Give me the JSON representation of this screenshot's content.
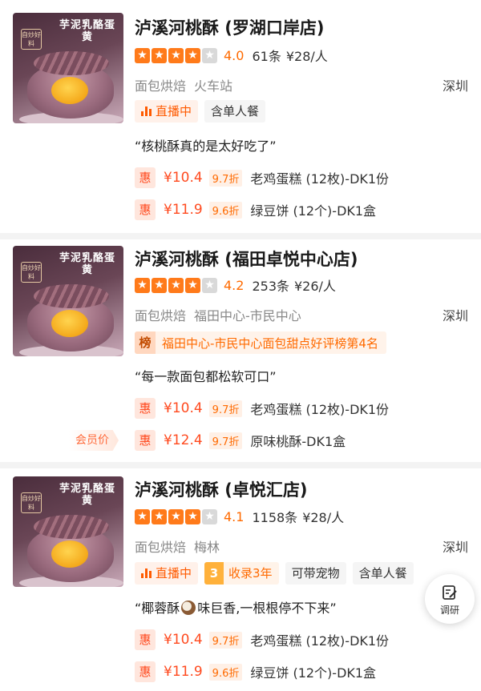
{
  "listings": [
    {
      "image_banner": "芋泥乳酪蛋黄",
      "image_badge": "自炒好料",
      "title": "泸溪河桃酥 (罗湖口岸店)",
      "stars_filled": 4,
      "score": "4.0",
      "reviews": "61条",
      "price": "¥28/人",
      "category": "面包烘焙",
      "area": "火车站",
      "city": "深圳",
      "tags": [
        "直播中",
        "含单人餐"
      ],
      "quote": "“核桃酥真的是太好吃了”",
      "deals": [
        {
          "badge": "惠",
          "price": "¥10.4",
          "discount": "9.7折",
          "name": "老鸡蛋糕 (12枚)-DK1份"
        },
        {
          "badge": "惠",
          "price": "¥11.9",
          "discount": "9.6折",
          "name": "绿豆饼 (12个)-DK1盒"
        }
      ]
    },
    {
      "image_banner": "芋泥乳酪蛋黄",
      "image_badge": "自炒好料",
      "title": "泸溪河桃酥 (福田卓悦中心店)",
      "stars_filled": 4,
      "score": "4.2",
      "reviews": "253条",
      "price": "¥26/人",
      "category": "面包烘焙",
      "area": "福田中心-市民中心",
      "city": "深圳",
      "rank_badge": "榜",
      "rank_text": "福田中心-市民中心面包甜点好评榜第4名",
      "quote": "“每一款面包都松软可口”",
      "member_label": "会员价",
      "deals": [
        {
          "badge": "惠",
          "price": "¥10.4",
          "discount": "9.7折",
          "name": "老鸡蛋糕 (12枚)-DK1份"
        },
        {
          "badge": "惠",
          "price": "¥12.4",
          "discount": "9.7折",
          "name": "原味桃酥-DK1盒"
        }
      ]
    },
    {
      "image_banner": "芋泥乳酪蛋黄",
      "image_badge": "自炒好料",
      "title": "泸溪河桃酥 (卓悦汇店)",
      "stars_filled": 4,
      "score": "4.1",
      "reviews": "1158条",
      "price": "¥28/人",
      "category": "面包烘焙",
      "area": "梅林",
      "city": "深圳",
      "tags": [
        "直播中",
        "收录3年",
        "可带宠物",
        "含单人餐"
      ],
      "years_num": "3",
      "years_text": "收录3年",
      "quote_before": "“椰蓉酥",
      "quote_after": "味巨香,一根根停不下来”",
      "deals": [
        {
          "badge": "惠",
          "price": "¥10.4",
          "discount": "9.7折",
          "name": "老鸡蛋糕 (12枚)-DK1份"
        },
        {
          "badge": "惠",
          "price": "¥11.9",
          "discount": "9.6折",
          "name": "绿豆饼 (12个)-DK1盒"
        }
      ]
    }
  ],
  "floating_button": {
    "label": "调研",
    "icon": "edit-note-icon"
  },
  "colors": {
    "accent": "#ff6a00",
    "deal_red": "#ff4a1f",
    "star": "#ff7a1a"
  }
}
